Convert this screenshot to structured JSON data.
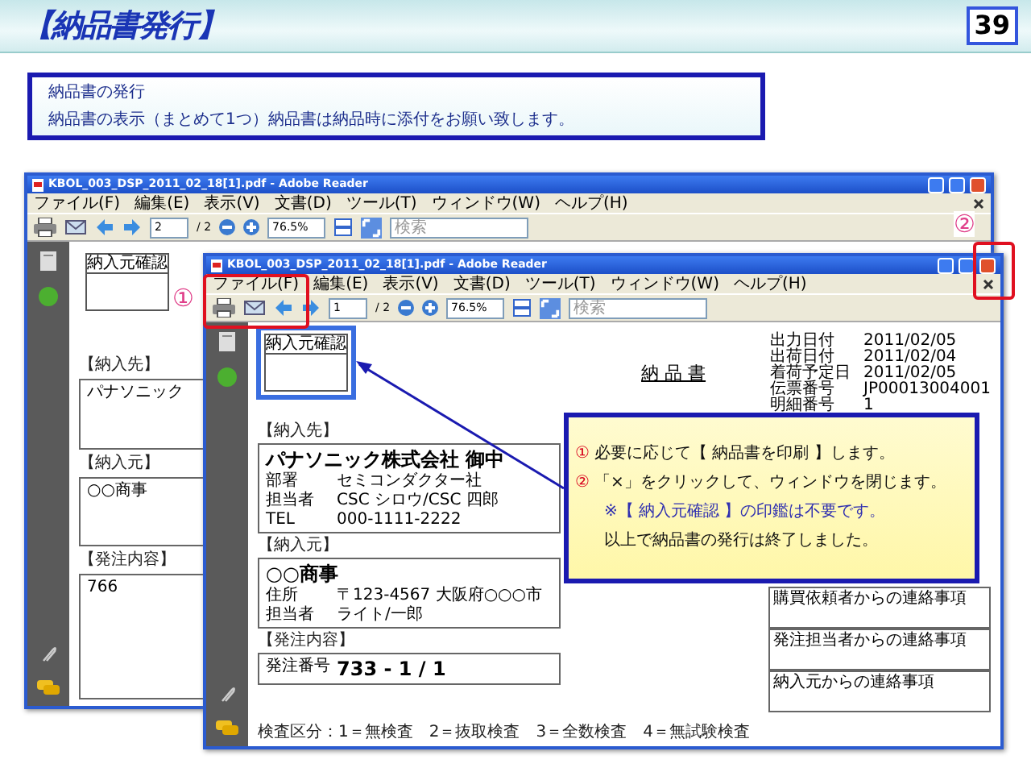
{
  "header": {
    "title": "【納品書発行】",
    "page_number": "39"
  },
  "intro": {
    "lines": [
      "納品書の発行",
      "納品書の表示（まとめて1つ）納品書は納品時に添付をお願い致します。"
    ]
  },
  "back_window": {
    "title": "KBOL_003_DSP_2011_02_18[1].pdf - Adobe Reader",
    "menu": [
      "ファイル(F)",
      "編集(E)",
      "表示(V)",
      "文書(D)",
      "ツール(T)",
      "ウィンドウ(W)",
      "ヘルプ(H)"
    ],
    "page": "2",
    "page_total": "/ 2",
    "zoom": "76.5%",
    "search_placeholder": "検索",
    "document": {
      "confirm_label": "納入元確認",
      "sections": [
        {
          "heading": "【納入先】",
          "line": "パナソニック"
        },
        {
          "heading": "【納入元】",
          "line": "○○商事"
        },
        {
          "heading": "【発注内容】",
          "line": "766"
        }
      ]
    }
  },
  "front_window": {
    "title": "KBOL_003_DSP_2011_02_18[1].pdf - Adobe Reader",
    "menu": [
      "ファイル(F)",
      "編集(E)",
      "表示(V)",
      "文書(D)",
      "ツール(T)",
      "ウィンドウ(W)",
      "ヘルプ(H)"
    ],
    "page": "1",
    "page_total": "/ 2",
    "zoom": "76.5%",
    "search_placeholder": "検索",
    "document": {
      "confirm_label": "納入元確認",
      "title": "納 品 書",
      "meta": [
        {
          "label": "出力日付",
          "value": "2011/02/05"
        },
        {
          "label": "出荷日付",
          "value": "2011/02/04"
        },
        {
          "label": "着荷予定日",
          "value": "2011/02/05"
        },
        {
          "label": "伝票番号",
          "value": "JP00013004001"
        },
        {
          "label": "明細番号",
          "value": "1"
        }
      ],
      "ship_to": {
        "heading": "【納入先】",
        "name": "パナソニック株式会社 御中",
        "rows": [
          {
            "label": "部署",
            "value": "セミコンダクター社"
          },
          {
            "label": "担当者",
            "value": "CSC シロウ/CSC 四郎"
          },
          {
            "label": "TEL",
            "value": "000-1111-2222"
          }
        ]
      },
      "supplier": {
        "heading": "【納入元】",
        "name": "○○商事",
        "rows": [
          {
            "label": "住所",
            "value": "〒123-4567 大阪府○○○市"
          },
          {
            "label": "担当者",
            "value": "ライト/一郎"
          }
        ]
      },
      "order": {
        "heading": "【発注内容】",
        "label": "発注番号",
        "value": "733 - 1 / 1"
      },
      "notes": [
        "購買依頼者からの連絡事項",
        "発注担当者からの連絡事項",
        "納入元からの連絡事項"
      ],
      "footer": "検査区分：1＝無検査　2＝抜取検査　3＝全数検査　4＝無試験検査"
    }
  },
  "markers": [
    {
      "label": "①"
    },
    {
      "label": "②"
    }
  ],
  "callout": {
    "lines": [
      {
        "kind": "step",
        "number": "①",
        "text": "必要に応じて【 納品書を印刷 】します。"
      },
      {
        "kind": "step",
        "number": "②",
        "text": "「×」をクリックして、ウィンドウを閉じます。"
      },
      {
        "kind": "note",
        "text": "※【 納入元確認 】の印鑑は不要です。"
      },
      {
        "kind": "plain",
        "text": "以上で納品書の発行は終了しました。"
      }
    ]
  }
}
